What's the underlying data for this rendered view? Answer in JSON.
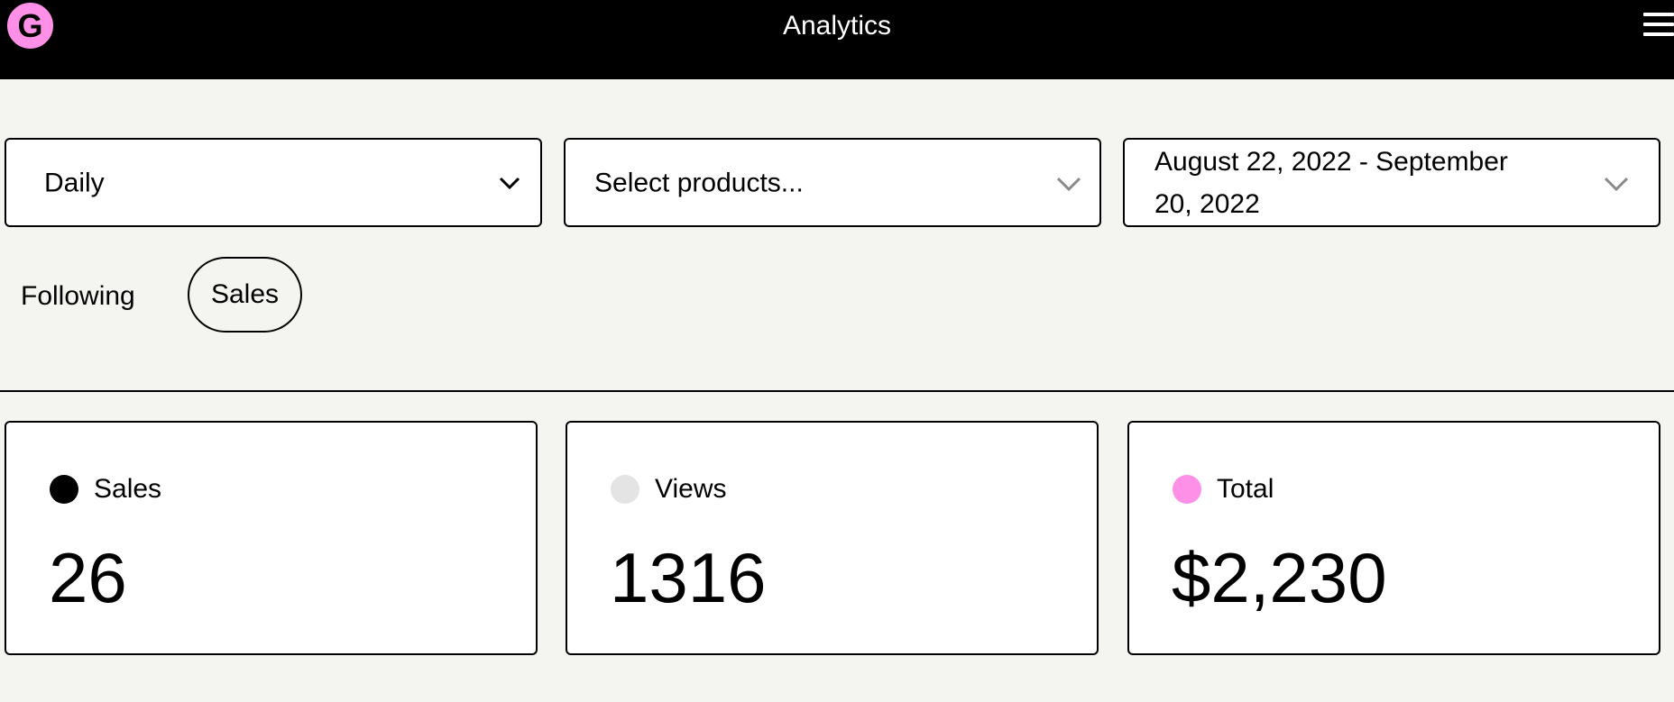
{
  "header": {
    "logo_letter": "G",
    "title": "Analytics",
    "logo_color": "#ff90e8"
  },
  "filters": {
    "granularity": "Daily",
    "products_placeholder": "Select products...",
    "date_range_line1": "August 22, 2022 - September",
    "date_range_line2": "20, 2022"
  },
  "following": {
    "label": "Following",
    "chip": "Sales"
  },
  "stats": [
    {
      "label": "Sales",
      "value": "26",
      "color": "#000000"
    },
    {
      "label": "Views",
      "value": "1316",
      "color": "#e4e4e4"
    },
    {
      "label": "Total",
      "value": "$2,230",
      "color": "#ff90e8"
    }
  ]
}
